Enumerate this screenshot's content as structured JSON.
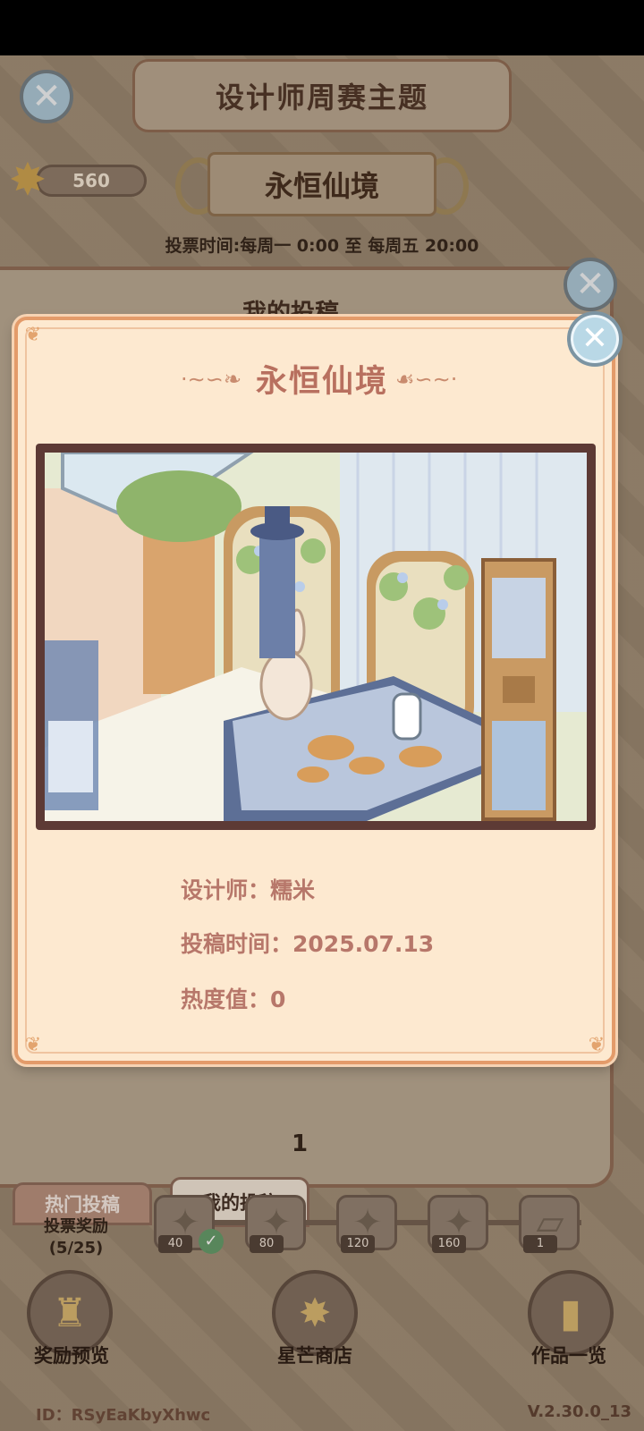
{
  "header": {
    "theme_title": "设计师周赛主题",
    "theme_name": "永恒仙境",
    "vote_time": "投票时间:每周一 0:00 至 每周五 20:00",
    "star_count": "560"
  },
  "back_panel": {
    "heading": "我的投稿",
    "page": "1"
  },
  "tabs": {
    "hot": "热门投稿",
    "mine": "我的投稿"
  },
  "progress": {
    "label": "投票奖励",
    "count": "(5/25)",
    "milestones": [
      "40",
      "80",
      "120",
      "160",
      "1"
    ]
  },
  "bottom": {
    "rewards_preview": "奖励预览",
    "star_shop": "星芒商店",
    "works_overview": "作品一览",
    "player_id": "ID：RSyEaKbyXhwc",
    "version": "V.2.30.0_13"
  },
  "modal": {
    "title": "永恒仙境",
    "designer_label": "设计师：",
    "designer_value": "糯米",
    "submit_time_label": "投稿时间：",
    "submit_time_value": "2025.07.13",
    "heat_label": "热度值：",
    "heat_value": "0"
  },
  "icons": {
    "close": "close-icon",
    "star": "star-icon",
    "check": "check-icon"
  },
  "colors": {
    "modal_bg": "#fde9d0",
    "modal_border": "#e39b6a",
    "title_color": "#b8705f",
    "info_color": "#b7776a",
    "close_blue": "#b9d8e6"
  }
}
